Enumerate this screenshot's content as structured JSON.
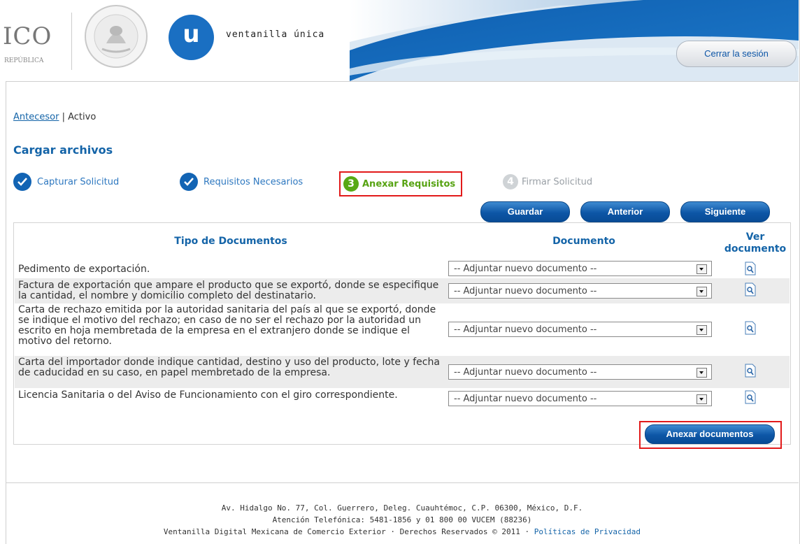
{
  "header": {
    "mex_text": "ICO",
    "mex_sub": "REPÚBLICA",
    "vu_logo_letter": "u",
    "vu_text": "ventanilla única",
    "logout_label": "Cerrar la sesión",
    "seal_text": "ESTADOS UNIDOS MEXICANOS"
  },
  "breadcrumb": {
    "link": "Antecesor",
    "separator": " | ",
    "current": "Activo"
  },
  "page_title": "Cargar archivos",
  "steps": [
    {
      "label": "Capturar Solicitud",
      "state": "done"
    },
    {
      "label": "Requisitos Necesarios",
      "state": "done"
    },
    {
      "number": "3",
      "label": "Anexar Requisitos",
      "state": "current"
    },
    {
      "number": "4",
      "label": "Firmar Solicitud",
      "state": "next"
    }
  ],
  "nav_buttons": {
    "save": "Guardar",
    "previous": "Anterior",
    "next": "Siguiente"
  },
  "table": {
    "headers": {
      "type": "Tipo de Documentos",
      "document": "Documento",
      "view": "Ver documento"
    },
    "rows": [
      {
        "description": "Pedimento de exportación.",
        "select_value": "-- Adjuntar nuevo documento --"
      },
      {
        "description": "Factura de exportación que ampare el producto que se exportó, donde se especifique la cantidad, el nombre y domicilio completo del destinatario.",
        "select_value": "-- Adjuntar nuevo documento --"
      },
      {
        "description": "Carta de rechazo emitida por la autoridad sanitaria del país al que se exportó, donde se indique el motivo del rechazo; en caso de no ser el rechazo por la autoridad un escrito en hoja membretada de la empresa en el extranjero donde se indique el motivo del retorno.",
        "select_value": "-- Adjuntar nuevo documento --"
      },
      {
        "description": "Carta del importador donde indique cantidad, destino y uso del producto, lote y fecha de caducidad en su caso, en papel membretado de la empresa.",
        "select_value": "-- Adjuntar nuevo documento --"
      },
      {
        "description": "Licencia Sanitaria o del Aviso de Funcionamiento con el giro correspondiente.",
        "select_value": "-- Adjuntar nuevo documento --"
      }
    ]
  },
  "attach_button": "Anexar documentos",
  "footer": {
    "line1": "Av. Hidalgo No. 77, Col. Guerrero, Deleg. Cuauhtémoc, C.P. 06300, México, D.F.",
    "line2": "Atención Telefónica: 5481-1856 y 01 800 00 VUCEM (88236)",
    "line3": "Ventanilla Digital Mexicana de Comercio Exterior · Derechos Reservados © 2011 · ",
    "privacy_link": "Políticas de Privacidad"
  },
  "colors": {
    "brand_blue": "#1464a8",
    "button_blue": "#0d56a6",
    "current_step_green": "#57a313",
    "highlight_red": "#e21a1a"
  }
}
